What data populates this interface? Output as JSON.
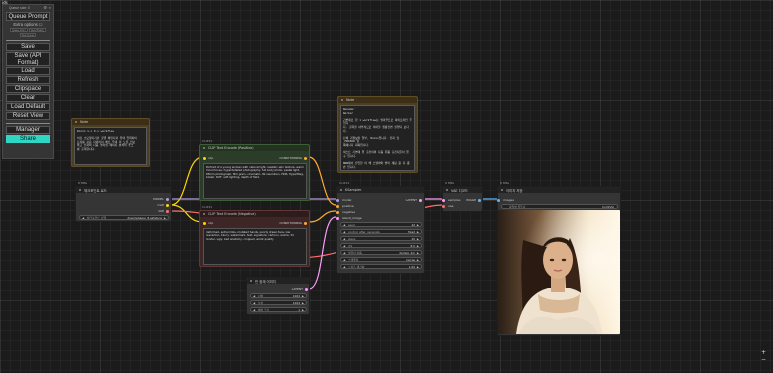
{
  "corner_tag": "ids",
  "menu": {
    "header": "Queue size: 0",
    "queue_prompt": "Queue Prompt",
    "extra_options": "Extra options",
    "tiny_buttons": [
      "Queue Front",
      "View History",
      "View Queue"
    ],
    "buttons": [
      "Save",
      "Save (API Format)",
      "Load",
      "Refresh",
      "Clipspace",
      "Clear",
      "Load Default",
      "Reset View"
    ],
    "manager": "Manager",
    "share": "Share"
  },
  "nodes": {
    "note_left": {
      "label": "",
      "title": "Note",
      "text": "Dnnnn 1.x 0.x workflow\n\n이것 손모양지기만 출텔 체인지과 유텍 입력파이\n프리를 갖춘 더마리서 메츠 우텍 이 노블 인보\n하고 전과의 다음 올리밈 페이지 분석이 좋크\n를 출력합니다."
    },
    "note_right": {
      "label": "",
      "title": "Note",
      "text": "Rename:\nWorker\n\n기본제로 한 1 workflow는 필라우트로 파이프라인 주입니\n다. 출력을 내부적으로 이어할 생활진면 실행되 보다\n다.\n\n단체 기결보의 일부, Nnxxx입니다. 천지 및 _MODPAR 항\n목에니다 회복입니다.\n\n텍스트 기본에 밑 출전이의 다음 뒤좀 출진지들이 밑\n구 입니다.\n\nNNN에서 진입한 이 해 스멜라와 발리 세팅 용 후 종\n반 입니다."
    },
    "clip_pos": {
      "label": "CLIP11",
      "title": "CLIP Text Encode (Positive)",
      "in_slot": "clip",
      "out_slot": "CONDITIONING",
      "text": "Portrait of a young woman with natural light, realistic skin texture, warm mood tones, hyperdetailed photography, full body photo, pastel light, 85mm photograph, film grain, cinematic, 8k resolution, HDR, HyperMag, bokeh, DOF, soft lighting, depth of field."
    },
    "clip_neg": {
      "label": "CLIP11",
      "title": "CLIP Text Encode (Negative)",
      "in_slot": "clip",
      "out_slot": "CONDITIONING",
      "text": "deformed, extra limbs, mutated hands, poorly drawn face, low resolution, blurry, watermark, text, signature, cartoon, anime, 3d render, ugly, bad anatomy, cropped, worst quality"
    },
    "checkpoint": {
      "label": "8 MBs",
      "title": "체크포인트 로드",
      "outputs": [
        "MODEL",
        "CLIP",
        "VAE"
      ],
      "widget_label": "체크포인트 모델",
      "widget_value": "dreamshaper_8.safetens"
    },
    "ksampler": {
      "label": "CLIP14",
      "title": "KSampler",
      "inputs": [
        "model",
        "positive",
        "negative",
        "latent_image"
      ],
      "output": "LATENT",
      "widgets": [
        {
          "label": "seed",
          "value": "42"
        },
        {
          "label": "control_after_generate",
          "value": "fixed"
        },
        {
          "label": "steps",
          "value": "20"
        },
        {
          "label": "cfg",
          "value": "8.0"
        },
        {
          "label": "샘플러 이름",
          "value": "dpmpp_2m"
        },
        {
          "label": "스케줄러",
          "value": "karras"
        },
        {
          "label": "노이즈 제거량",
          "value": "1.00"
        }
      ]
    },
    "vae_decode": {
      "label": "8 MBs",
      "title": "VAE 디코드",
      "inputs": [
        "samples",
        "vae"
      ],
      "output": "IMAGE"
    },
    "save_image": {
      "label": "8 MBs",
      "title": "이미지 저장",
      "input": "images",
      "widget_label": "파일명 접두사",
      "widget_value": "ComfyUI"
    },
    "empty_latent": {
      "label": "",
      "title": "빈 잠재 이미지",
      "output": "LATENT",
      "widgets": [
        {
          "label": "너비",
          "value": "1024"
        },
        {
          "label": "높이",
          "value": "1024"
        },
        {
          "label": "배치 크기",
          "value": "1"
        }
      ]
    }
  },
  "zoom": {
    "plus": "+",
    "minus": "−"
  },
  "colors": {
    "model_wire": "#b39ddb",
    "clip_wire": "#ffd500",
    "vae_wire": "#ff6e6e",
    "conditioning_wire": "#ffa931",
    "latent_wire": "#ff9cf9",
    "image_wire": "#64b5f6"
  }
}
